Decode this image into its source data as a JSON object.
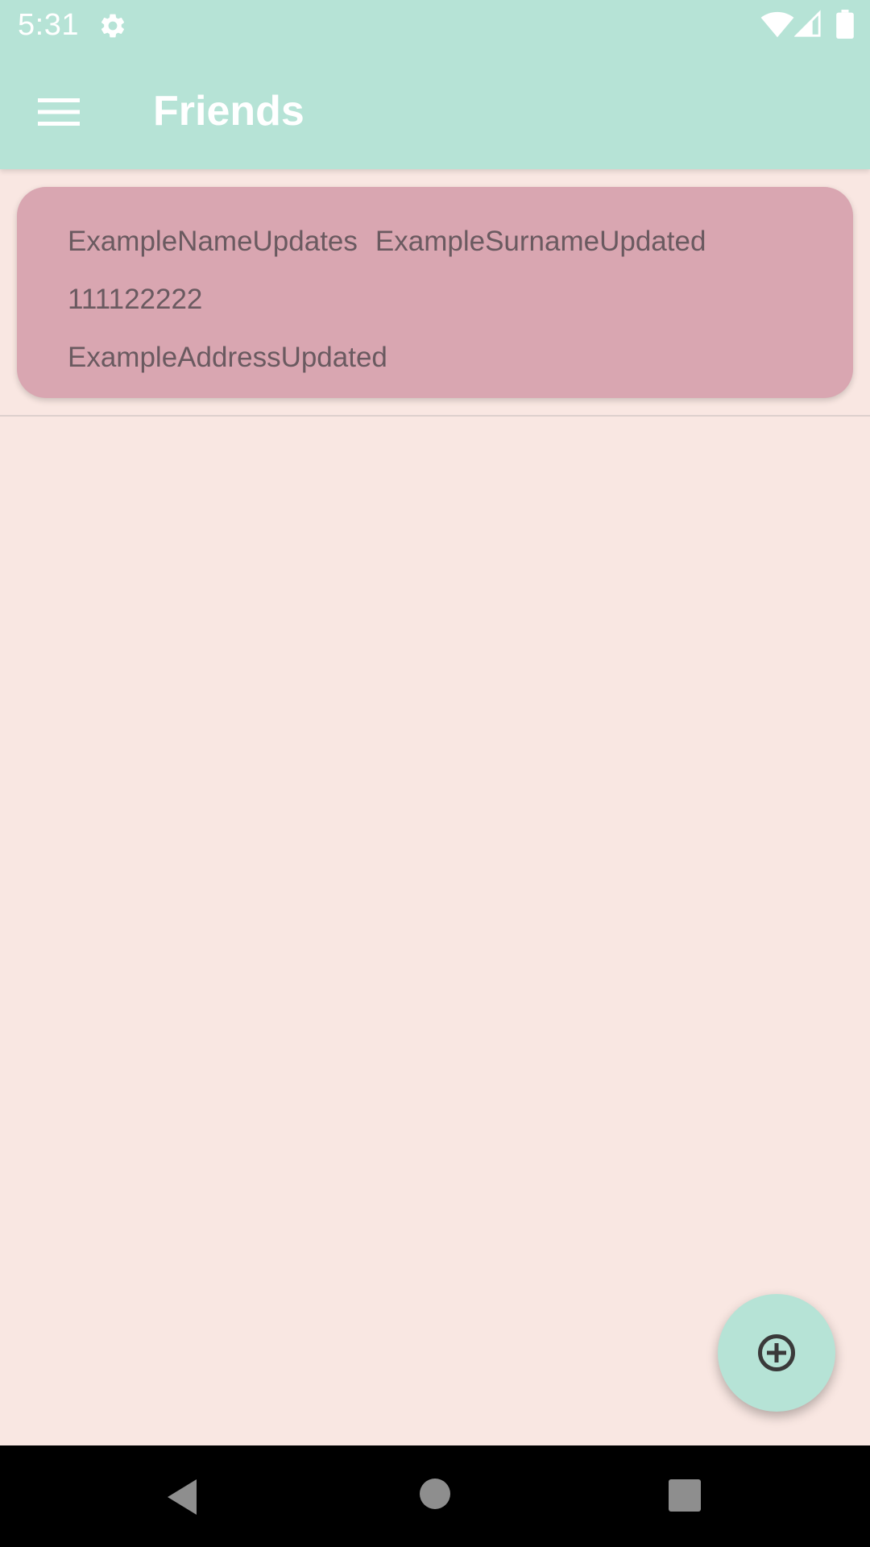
{
  "status_bar": {
    "time": "5:31",
    "icons": [
      "gear-icon",
      "wifi-icon",
      "cell-signal-icon",
      "battery-icon"
    ]
  },
  "app_bar": {
    "title": "Friends",
    "menu_icon": "hamburger-menu-icon",
    "background_color": "#b6e3d6"
  },
  "friends": [
    {
      "name": "ExampleNameUpdates",
      "surname": "ExampleSurnameUpdated",
      "phone": "111122222",
      "address": "ExampleAddressUpdated"
    }
  ],
  "fab": {
    "icon": "add-circle-icon"
  },
  "nav_bar": {
    "icons": [
      "back-icon",
      "home-icon",
      "recents-icon"
    ]
  },
  "colors": {
    "background": "#f9e7e2",
    "card": "#d9a6b1",
    "accent": "#b6e3d6"
  }
}
